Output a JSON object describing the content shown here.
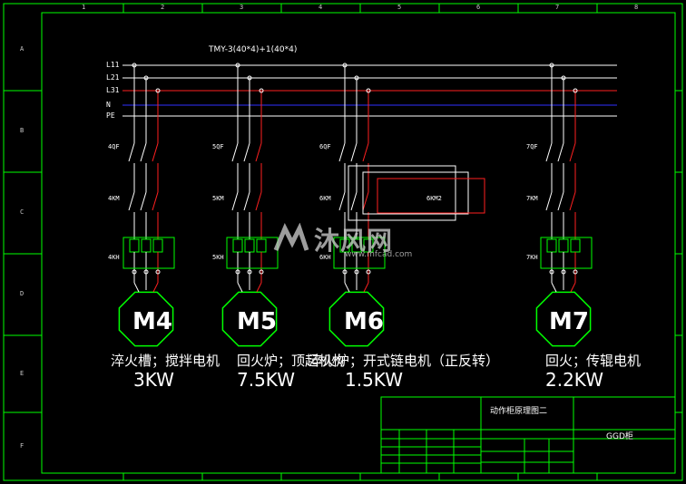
{
  "cable_spec": "TMY-3(40*4)+1(40*4)",
  "buses": [
    "L11",
    "L21",
    "L31",
    "N",
    "PE"
  ],
  "breakers": [
    "4QF",
    "5QF",
    "6QF",
    "7QF"
  ],
  "contactors": [
    "4KM",
    "5KM",
    "6KM",
    "6KM2",
    "7KM"
  ],
  "relays": [
    "4KH",
    "5KH",
    "6KH",
    "7KH"
  ],
  "motors": [
    {
      "id": "M4",
      "desc": "淬火槽；搅拌电机",
      "power": "3KW"
    },
    {
      "id": "M5",
      "desc": "回火炉；顶起机构",
      "power": "7.5KW"
    },
    {
      "id": "M6",
      "desc": "淬火炉；开式链电机（正反转）",
      "power": "1.5KW"
    },
    {
      "id": "M7",
      "desc": "回火；传辊电机",
      "power": "2.2KW"
    }
  ],
  "title_block": {
    "drawing_title": "动作柜原理图二",
    "cabinet": "GGD柜"
  },
  "watermark": {
    "brand": "沐风网",
    "url": "www.mfcad.com"
  },
  "frame": {
    "cols_top": [
      "1",
      "2",
      "3",
      "4",
      "5",
      "6",
      "7",
      "8"
    ],
    "rows_left": [
      "A",
      "B",
      "C",
      "D",
      "E",
      "F"
    ]
  },
  "colors": {
    "background": "#000000",
    "frame": "#00ff00",
    "wire_white": "#ffffff",
    "wire_red": "#ff2020",
    "n_line": "#3030ff",
    "motor": "#00ff00"
  }
}
